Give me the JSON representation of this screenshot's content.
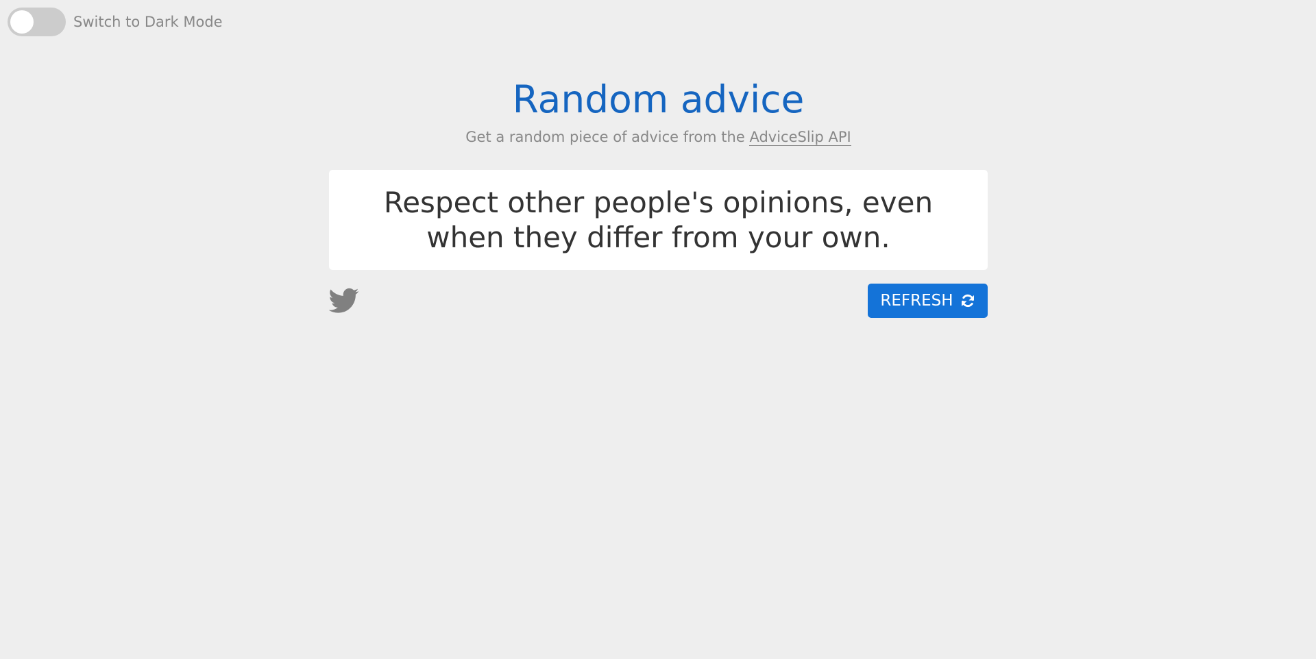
{
  "theme_toggle": {
    "label": "Switch to Dark Mode",
    "state": "off"
  },
  "header": {
    "title": "Random advice",
    "subtitle_prefix": "Get a random piece of advice from the ",
    "api_link_text": "AdviceSlip API"
  },
  "advice": {
    "text": "Respect other people's opinions, even when they differ from your own."
  },
  "actions": {
    "tweet_icon": "twitter-icon",
    "refresh_label": "REFRESH",
    "refresh_icon": "refresh-icon"
  },
  "colors": {
    "background": "#eeeeee",
    "title": "#1565c0",
    "button": "#1473d8",
    "muted_text": "#888888",
    "card": "#ffffff"
  }
}
